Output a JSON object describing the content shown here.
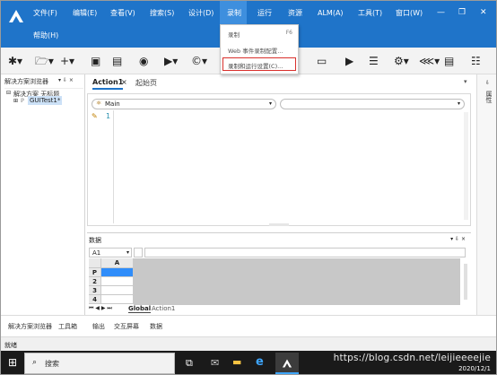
{
  "menubar": {
    "items": [
      "文件(F)",
      "编辑(E)",
      "查看(V)",
      "搜索(S)",
      "设计(D)",
      "录制",
      "运行",
      "资源",
      "ALM(A)",
      "工具(T)",
      "窗口(W)"
    ],
    "second_row": "帮助(H)",
    "active": "录制",
    "accent": "#1f74c9"
  },
  "record_menu": {
    "items": [
      {
        "label": "录制",
        "shortcut": "F6"
      },
      {
        "label": "Web 事件录制配置...",
        "shortcut": ""
      },
      {
        "label": "录制和运行设置(C)...",
        "shortcut": ""
      }
    ],
    "highlight_color": "#d9302c"
  },
  "explorer": {
    "title": "解决方案浏览器",
    "pin": "▾ ⇩ ×",
    "solution_label": "解决方案 无标题",
    "test_label": "GUITest1*"
  },
  "editor": {
    "tabs": [
      "Action1",
      "起始页"
    ],
    "combo_value": "Main",
    "line_number": "1"
  },
  "right_rail": {
    "label": "属性"
  },
  "data_pane": {
    "title": "数据",
    "cell_ref": "A1",
    "column": "A",
    "row_headers": [
      "P",
      "2",
      "3",
      "4"
    ],
    "sheet_tabs": [
      "Global",
      "Action1"
    ],
    "selection_color": "#2f8dfa"
  },
  "bottom_tabs": [
    "解决方案浏览器",
    "工具箱",
    "输出",
    "交互屏幕",
    "数据"
  ],
  "status": "就绪",
  "taskbar": {
    "search_placeholder": "搜索",
    "watermark": "https://blog.csdn.net/leijieeeejie",
    "date": "2020/12/1"
  }
}
